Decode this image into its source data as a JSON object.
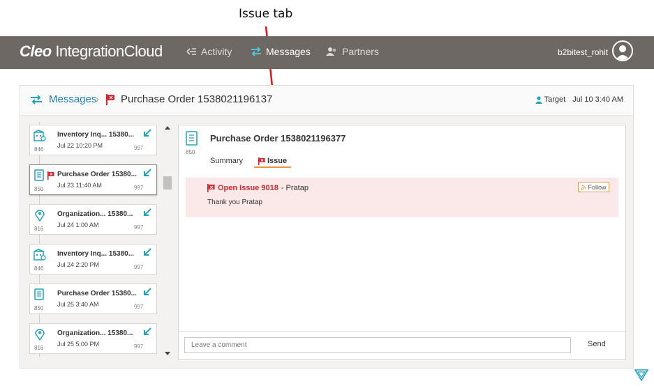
{
  "annotation": {
    "label": "Issue tab"
  },
  "app": {
    "logo_bold": "Cleo",
    "logo_rest": "IntegrationCloud",
    "user": "b2bitest_rohit"
  },
  "nav": [
    {
      "label": "Activity",
      "icon": "activity-icon"
    },
    {
      "label": "Messages",
      "icon": "swap-arrows-icon",
      "active": true
    },
    {
      "label": "Partners",
      "icon": "partners-icon"
    }
  ],
  "breadcrumb": {
    "root": "Messages",
    "separator": "›",
    "current": "Purchase Order 1538021196137"
  },
  "target": {
    "label": "Target",
    "time": "Jul 10 3:40 AM"
  },
  "messages": [
    {
      "code": "846",
      "title": "Inventory Inq... 15380...",
      "time": "Jul 22 10:20 PM",
      "num": "997",
      "icon": "building-icon",
      "flag": false
    },
    {
      "code": "850",
      "title": "Purchase Order 15380...",
      "time": "Jul 23 11:40 AM",
      "num": "997",
      "icon": "document-icon",
      "flag": true,
      "selected": true
    },
    {
      "code": "816",
      "title": "Organization... 15380...",
      "time": "Jul 24 1:00 AM",
      "num": "997",
      "icon": "location-pin-icon",
      "flag": false
    },
    {
      "code": "846",
      "title": "Inventory Inq... 15380...",
      "time": "Jul 24 2:20 PM",
      "num": "997",
      "icon": "building-icon",
      "flag": false
    },
    {
      "code": "850",
      "title": "Purchase Order 15380...",
      "time": "Jul 25 3:40 AM",
      "num": "997",
      "icon": "document-icon",
      "flag": false
    },
    {
      "code": "816",
      "title": "Organization... 15380...",
      "time": "Jul 25 5:00 PM",
      "num": "997",
      "icon": "location-pin-icon",
      "flag": false
    }
  ],
  "detail": {
    "code": "850",
    "title": "Purchase Order 1538021196377",
    "tabs": {
      "summary": "Summary",
      "issue": "Issue"
    },
    "issue": {
      "title": "Open Issue 9018",
      "author": "- Pratap",
      "message": "Thank you Pratap",
      "follow": "Follow"
    },
    "comment": {
      "placeholder": "Leave a comment",
      "send": "Send"
    }
  },
  "colors": {
    "accent": "#1fa3b8",
    "flag": "#d8262d",
    "topbar": "#6e6865",
    "issue_bg": "#fbe9ea",
    "link": "#1f7db8"
  }
}
